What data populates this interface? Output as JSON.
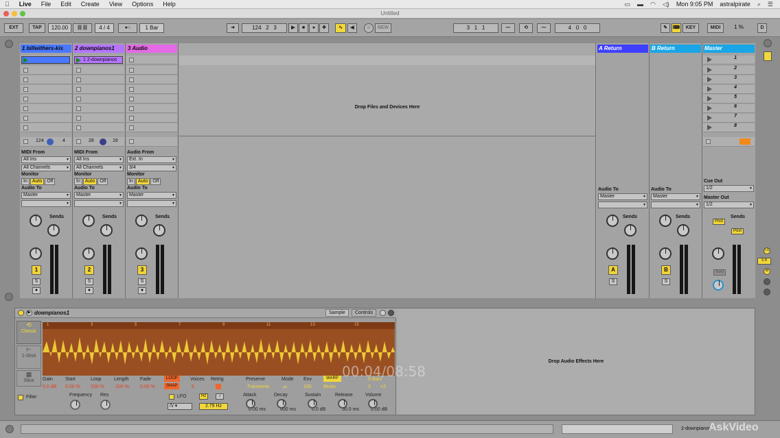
{
  "menubar": {
    "app": "Live",
    "items": [
      "File",
      "Edit",
      "Create",
      "View",
      "Options",
      "Help"
    ],
    "clock": "Mon 9:05 PM",
    "user": "astralpirate"
  },
  "window": {
    "title": "Untitled"
  },
  "control": {
    "ext": "EXT",
    "tap": "TAP",
    "tempo": "120.00",
    "sig": "4 / 4",
    "quant": "1 Bar",
    "pos": [
      "124",
      "2",
      "3"
    ],
    "new": "NEW",
    "loop_start": [
      "3",
      "1",
      "1"
    ],
    "loop_len": [
      "4",
      "0",
      "0"
    ],
    "key": "KEY",
    "midi": "MIDI",
    "cpu": "1 %",
    "d": "D"
  },
  "tracks": [
    {
      "name": "1 billwithers-kis",
      "color": "#4a78ff",
      "clip_name": "",
      "clip_color": "#4a78ff",
      "num": "1",
      "in_label": "MIDI From",
      "in_sel": "All Ins",
      "ch_sel": "All Channels",
      "extra": [
        "124",
        "4"
      ]
    },
    {
      "name": "2 downpianos1",
      "color": "#b675ff",
      "clip_name": "1 2-downpianos",
      "clip_color": "#b675ff",
      "num": "2",
      "in_label": "MIDI From",
      "in_sel": "All Ins",
      "ch_sel": "All Channels",
      "extra": [
        "28",
        "16"
      ]
    },
    {
      "name": "3 Audio",
      "color": "#e46ae6",
      "clip_name": "",
      "clip_color": "",
      "num": "3",
      "in_label": "Audio From",
      "in_sel": "Ext. In",
      "ch_sel": "3/4",
      "extra": [
        "",
        ""
      ]
    }
  ],
  "monitor": {
    "label": "Monitor",
    "in": "In",
    "auto": "Auto",
    "off": "Off"
  },
  "audio_to": {
    "label": "Audio To",
    "value": "Master"
  },
  "sends": "Sends",
  "returns": [
    {
      "name": "A Return",
      "color": "#3f3fff",
      "letter": "A"
    },
    {
      "name": "B Return",
      "color": "#19a6e6",
      "letter": "B"
    }
  ],
  "master": {
    "name": "Master",
    "color": "#19a6e6",
    "scenes": [
      "1",
      "2",
      "3",
      "4",
      "5",
      "6",
      "7",
      "8"
    ],
    "cue_label": "Cue Out",
    "cue": "1/2",
    "out_label": "Master Out",
    "out": "1/2",
    "post": "Post",
    "solo": "Solo"
  },
  "drop_files": "Drop Files and Devices Here",
  "device": {
    "name": "downpianos1",
    "sample": "Sample",
    "controls": "Controls",
    "modes": [
      "Classic",
      "1-Shot",
      "Slice"
    ],
    "params": [
      {
        "label": "Gain",
        "value": "0.0 dB"
      },
      {
        "label": "Start",
        "value": "0.00 %"
      },
      {
        "label": "Loop",
        "value": "100 %"
      },
      {
        "label": "Length",
        "value": "100 %"
      },
      {
        "label": "Fade",
        "value": "0.00 %"
      },
      {
        "label": "Voices",
        "value": "6"
      },
      {
        "label": "Retrig",
        "value": ""
      }
    ],
    "loop_btn": "LOOP",
    "snap_btn": "SNAP",
    "preserve": "Preserve",
    "transients": "Transients",
    "mode_lbl": "Mode",
    "env_lbl": "Env",
    "env_val": "100",
    "warp": "WARP",
    "bars": "8 Bars",
    "beats": "Beats",
    "two": "2",
    "x2": "×2",
    "filter": "Filter",
    "frequency": "Frequency",
    "res": "Res",
    "lfo": "LFO",
    "hz": "Hz",
    "lfo_rate": "2.79 Hz",
    "attack": {
      "label": "Attack",
      "value": "0.00 ms"
    },
    "decay": {
      "label": "Decay",
      "value": "600 ms"
    },
    "sustain": {
      "label": "Sustain",
      "value": "0.0 dB"
    },
    "release": {
      "label": "Release",
      "value": "50.0 ms"
    },
    "volume": {
      "label": "Volume",
      "value": "0.00 dB"
    },
    "ruler": [
      "1",
      "3",
      "5",
      "7",
      "9",
      "11",
      "13",
      "15"
    ]
  },
  "drop_effects": "Drop Audio Effects Here",
  "overlay": {
    "timecode": "00:04/08:58",
    "watermark": "AskVideo"
  },
  "status": {
    "selected": "2-downpianos"
  }
}
